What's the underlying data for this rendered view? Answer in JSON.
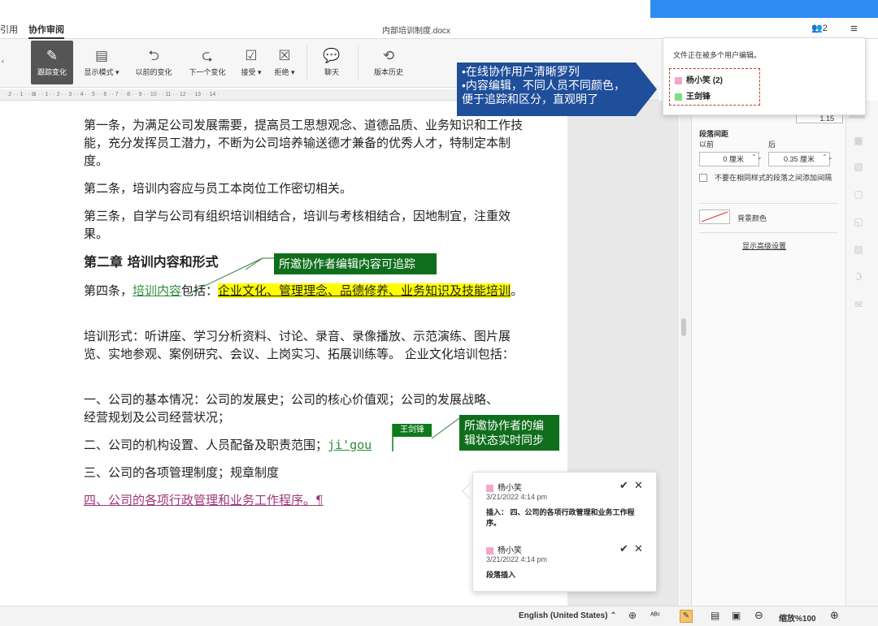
{
  "titlebar": {
    "tab_partial": "引用",
    "tab_active": "协作审阅",
    "doc_title": "内部培训制度.docx",
    "user_count": "2"
  },
  "toolbar": {
    "track_changes": "跟踪变化",
    "display_mode": "显示模式",
    "prev_change": "以前的变化",
    "next_change": "下一个变化",
    "accept": "接受",
    "reject": "拒绝",
    "chat": "聊天",
    "version_history": "版本历史"
  },
  "ruler": {
    "marks": "· 2 · · 1 · · ⊠ · · 1 · · 2 · · 3 · · 4 · · 5 · · 6 · · 7 · · 8 · · 9 · · 10 · · 11 · · 12 · · 13 · · 14 ·"
  },
  "document": {
    "para1": "第一条，为满足公司发展需要，提高员工思想观念、道德品质、业务知识和工作技能，充分发挥员工潜力，不断为公司培养输送德才兼备的优秀人才，特制定本制度。",
    "para2": "第二条，培训内容应与员工本岗位工作密切相关。",
    "para3": "第三条，自学与公司有组织培训相结合，培训与考核相结合，因地制宜，注重效果。",
    "heading2": "第二章 培训内容和形式",
    "para4_prefix": "第四条，",
    "para4_insert": "培训内容",
    "para4_mid": "包括：",
    "para4_highlight": "企业文化、管理理念、品德修养、业务知识及技能培训",
    "para4_end": "。",
    "para5": "培训形式：听讲座、学习分析资料、讨论、录音、录像播放、示范演练、图片展览、实地参观、案例研究、会议、上岗实习、拓展训练等。 企业文化培训包括：",
    "item1": "一、公司的基本情况：公司的发展史；公司的核心价值观；公司的发展战略、经营规划及公司经营状况；",
    "item2_prefix": "二、公司的机构设置、人员配备及职责范围；",
    "item2_typing": "ji'gou",
    "item3": "三、公司的各项管理制度；规章制度",
    "item4": "四、公司的各项行政管理和业务工作程序。¶"
  },
  "callouts": {
    "blue_line1": "•在线协作用户清晰罗列",
    "blue_line2": "•内容编辑，不同人员不同颜色，",
    "blue_line3": "便于追踪和区分，直观明了",
    "green_track": "所邀协作者编辑内容可追踪",
    "green_sync_line1": "所邀协作者的编",
    "green_sync_line2": "辑状态实时同步",
    "user_flag": "王剑锋"
  },
  "users_popup": {
    "message": "文件正在被多个用户编辑。",
    "users": [
      {
        "name": "杨小笑 (2)",
        "color": "#f4a6c8"
      },
      {
        "name": "王剑锋",
        "color": "#7ee07e"
      }
    ]
  },
  "right_panel": {
    "line_spacing_value": "1.15",
    "para_spacing": "段落间距",
    "before": "以前",
    "after": "后",
    "before_value": "0 厘米",
    "after_value": "0.35 厘米",
    "no_space_same_style": "不要在相同样式的段落之间添加间隔",
    "bg_color": "背景颜色",
    "advanced": "显示高级设置"
  },
  "comments": [
    {
      "author": "杨小笑",
      "date": "3/21/2022 4:14 pm",
      "body": "插入： 四、公司的各项行政管理和业务工作程序。"
    },
    {
      "author": "杨小笑",
      "date": "3/21/2022 4:14 pm",
      "body": "段落插入"
    }
  ],
  "statusbar": {
    "language": "English (United States)",
    "zoom": "缩放%100"
  },
  "colors": {
    "accent": "#2d8cf0",
    "callout_blue": "#1f4e9a",
    "callout_green": "#0f6e1c",
    "highlight": "#ffff00",
    "user1": "#f4a6c8",
    "user2": "#7ee07e"
  }
}
